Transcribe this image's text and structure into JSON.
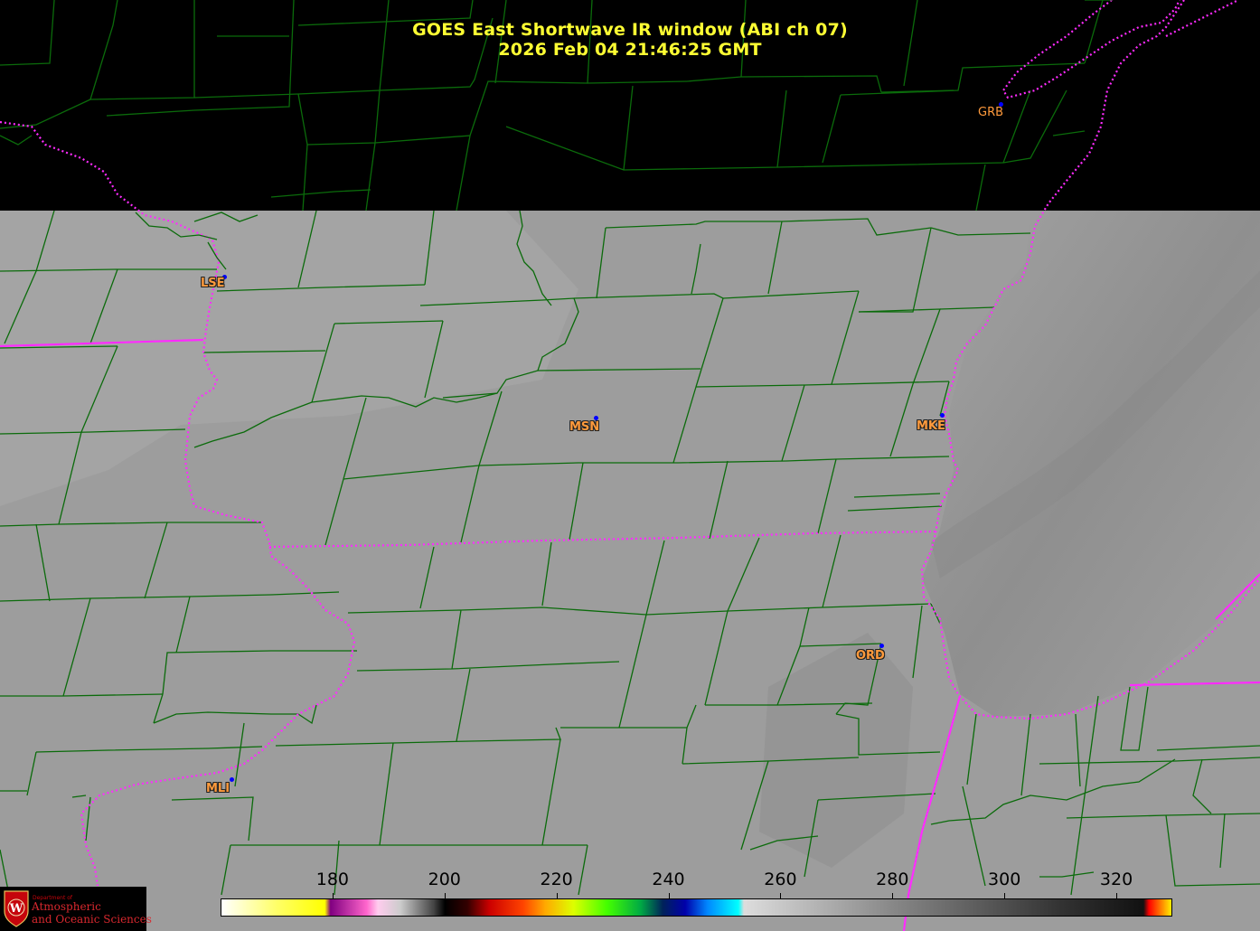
{
  "title": {
    "line1": "GOES East Shortwave IR window (ABI ch 07)",
    "line2": "2026 Feb 04  21:46:25 GMT"
  },
  "colors": {
    "county_lines": "#0b6b0b",
    "state_lines": "#ff2bff",
    "labels": "#ff9a3c",
    "title": "#ffff33",
    "station_marker": "#0000ff",
    "no_data": "#000000"
  },
  "stations": [
    {
      "code": "GRB",
      "style": "plain"
    },
    {
      "code": "LSE",
      "style": "outlined"
    },
    {
      "code": "MSN",
      "style": "outlined"
    },
    {
      "code": "MKE",
      "style": "outlined"
    },
    {
      "code": "ORD",
      "style": "outlined"
    },
    {
      "code": "MLI",
      "style": "outlined"
    }
  ],
  "colorbar": {
    "unit_range": [
      160,
      330
    ],
    "ticks": [
      "180",
      "200",
      "220",
      "240",
      "260",
      "280",
      "300",
      "320"
    ],
    "tick_values": [
      180,
      200,
      220,
      240,
      260,
      280,
      300,
      320
    ],
    "stops": [
      {
        "value": 160,
        "color": "#ffffff"
      },
      {
        "value": 170,
        "color": "#ffff66"
      },
      {
        "value": 178.5,
        "color": "#ffff00"
      },
      {
        "value": 179.5,
        "color": "#800080"
      },
      {
        "value": 186,
        "color": "#ff66cc"
      },
      {
        "value": 188,
        "color": "#ffccee"
      },
      {
        "value": 192,
        "color": "#cccccc"
      },
      {
        "value": 198,
        "color": "#444444"
      },
      {
        "value": 200,
        "color": "#000000"
      },
      {
        "value": 204,
        "color": "#330000"
      },
      {
        "value": 208,
        "color": "#cc0000"
      },
      {
        "value": 214,
        "color": "#ff4400"
      },
      {
        "value": 218,
        "color": "#ffaa00"
      },
      {
        "value": 223,
        "color": "#ddff00"
      },
      {
        "value": 229,
        "color": "#44ff00"
      },
      {
        "value": 235,
        "color": "#00aa44"
      },
      {
        "value": 239,
        "color": "#00225a"
      },
      {
        "value": 243,
        "color": "#0000aa"
      },
      {
        "value": 247,
        "color": "#0088ff"
      },
      {
        "value": 252.5,
        "color": "#00ffff"
      },
      {
        "value": 253.5,
        "color": "#dddddd"
      },
      {
        "value": 280,
        "color": "#888888"
      },
      {
        "value": 310,
        "color": "#333333"
      },
      {
        "value": 325,
        "color": "#111111"
      },
      {
        "value": 326,
        "color": "#ff0000"
      },
      {
        "value": 330,
        "color": "#ffee00"
      }
    ]
  },
  "logo": {
    "dept_line": "Department of",
    "line1": "Atmospheric",
    "line2": "and Oceanic Sciences",
    "seal_letter": "W"
  }
}
